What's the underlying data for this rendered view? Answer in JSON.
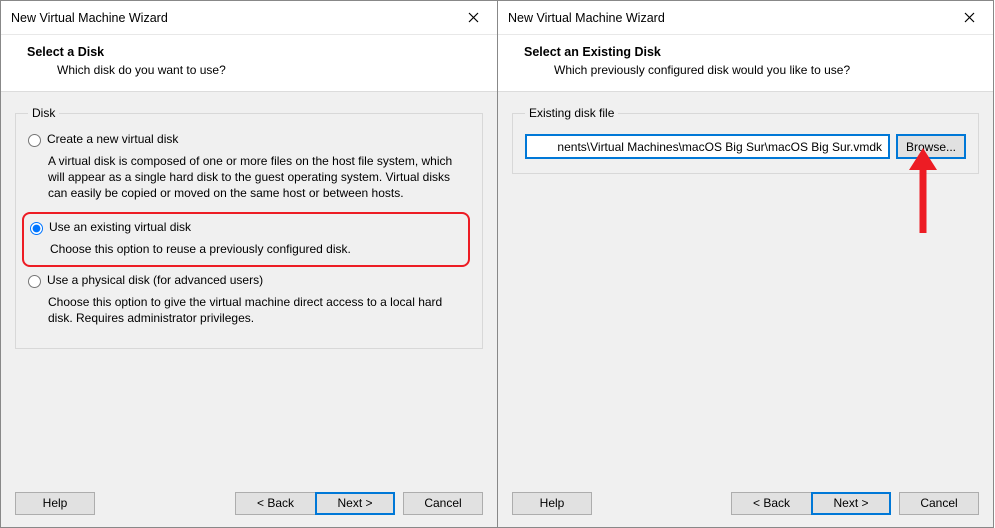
{
  "left": {
    "window_title": "New Virtual Machine Wizard",
    "heading": "Select a Disk",
    "subheading": "Which disk do you want to use?",
    "group_label": "Disk",
    "options": {
      "create": {
        "label": "Create a new virtual disk",
        "desc": "A virtual disk is composed of one or more files on the host file system, which will appear as a single hard disk to the guest operating system. Virtual disks can easily be copied or moved on the same host or between hosts."
      },
      "existing": {
        "label": "Use an existing virtual disk",
        "desc": "Choose this option to reuse a previously configured disk."
      },
      "physical": {
        "label": "Use a physical disk (for advanced users)",
        "desc": "Choose this option to give the virtual machine direct access to a local hard disk. Requires administrator privileges."
      }
    },
    "buttons": {
      "help": "Help",
      "back": "< Back",
      "next": "Next >",
      "cancel": "Cancel"
    }
  },
  "right": {
    "window_title": "New Virtual Machine Wizard",
    "heading": "Select an Existing Disk",
    "subheading": "Which previously configured disk would you like to use?",
    "group_label": "Existing disk file",
    "path_value": "nents\\Virtual Machines\\macOS Big Sur\\macOS Big Sur.vmdk",
    "browse_label": "Browse...",
    "buttons": {
      "help": "Help",
      "back": "< Back",
      "next": "Next >",
      "cancel": "Cancel"
    }
  }
}
